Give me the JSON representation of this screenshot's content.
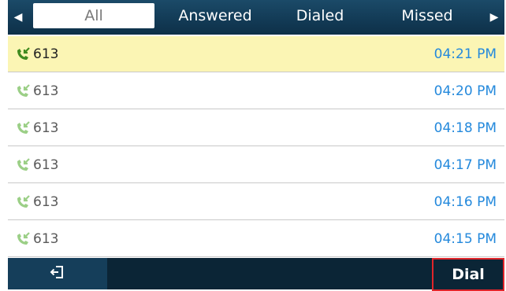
{
  "tabs": {
    "items": [
      {
        "label": "All",
        "active": true
      },
      {
        "label": "Answered",
        "active": false
      },
      {
        "label": "Dialed",
        "active": false
      },
      {
        "label": "Missed",
        "active": false
      }
    ],
    "prev_icon": "triangle-left-icon",
    "next_icon": "triangle-right-icon"
  },
  "calls": [
    {
      "number": "613",
      "time": "04:21 PM",
      "selected": true,
      "icon": "answered-call-icon"
    },
    {
      "number": "613",
      "time": "04:20 PM",
      "selected": false,
      "icon": "answered-call-icon"
    },
    {
      "number": "613",
      "time": "04:18 PM",
      "selected": false,
      "icon": "answered-call-icon"
    },
    {
      "number": "613",
      "time": "04:17 PM",
      "selected": false,
      "icon": "answered-call-icon"
    },
    {
      "number": "613",
      "time": "04:16 PM",
      "selected": false,
      "icon": "answered-call-icon"
    },
    {
      "number": "613",
      "time": "04:15 PM",
      "selected": false,
      "icon": "answered-call-icon"
    }
  ],
  "softkeys": {
    "back_icon": "exit-icon",
    "dial_label": "Dial"
  },
  "colors": {
    "tab_bar": "#123a55",
    "selected_row": "#fbf5b4",
    "time_text": "#2489dc",
    "dial_highlight": "#e0252a",
    "icon_selected": "#3f8a1f",
    "icon_normal": "#9bcf86"
  }
}
